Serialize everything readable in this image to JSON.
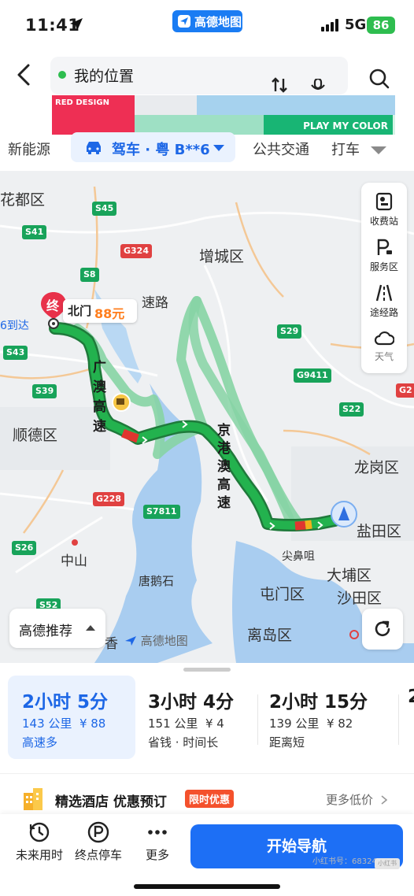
{
  "status_bar": {
    "time": "11:41",
    "network": "5G",
    "battery": "86",
    "app_badge": "高德地图"
  },
  "header": {
    "origin_text": "我的位置",
    "ad_banner": {
      "left_text": "RED DESIGN",
      "right_text": "PLAY MY COLOR"
    }
  },
  "mode_tabs": {
    "items": [
      "新能源",
      "驾车 · 粤 B**6",
      "公共交通",
      "打车"
    ],
    "active_index": 1
  },
  "map": {
    "labels": [
      "花都区",
      "增城区",
      "顺德区",
      "龙岗区",
      "中山",
      "唐鹅石",
      "屯门区",
      "大埔区",
      "沙田区",
      "离岛区",
      "盐田区",
      "尖鼻咀",
      "6到达",
      "香"
    ],
    "road_tags": [
      "S45",
      "S41",
      "G324",
      "S8",
      "S29",
      "S43",
      "G9411",
      "S39",
      "S22",
      "G228",
      "S7811",
      "S26",
      "S52",
      "G2"
    ],
    "route_texts": [
      "广澳高速",
      "京港澳高速",
      "速路"
    ],
    "dest_marker": "终",
    "parking": {
      "name": "北门",
      "icon_letter": "P",
      "price": "88元"
    },
    "tools": [
      "收费站",
      "服务区",
      "途经路",
      "天气"
    ],
    "recommend_button": "高德推荐",
    "watermark": "高德地图"
  },
  "routes": [
    {
      "duration": "2小时 5分",
      "distance": "143 公里",
      "toll": "¥ 88",
      "tag": "高速多",
      "selected": true
    },
    {
      "duration": "3小时 4分",
      "distance": "151 公里",
      "toll": "¥ 4",
      "tag": "省钱 · 时间长",
      "selected": false
    },
    {
      "duration": "2小时 15分",
      "distance": "139 公里",
      "toll": "¥ 82",
      "tag": "距离短",
      "selected": false
    },
    {
      "duration": "2",
      "distance": "",
      "toll": "",
      "tag": "",
      "selected": false
    }
  ],
  "hotel_promo": {
    "title": "精选酒店 优惠预订",
    "badge": "限时优惠",
    "more": "更多低价"
  },
  "bottom_bar": {
    "future_time": "未来用时",
    "dest_parking": "终点停车",
    "more": "更多",
    "start_nav": "开始导航",
    "watermark": "小红书号：683240911",
    "xhs_logo": "小红书"
  },
  "colors": {
    "brand_blue": "#1d6ff5",
    "route_green": "#23b24e",
    "alt_route_green": "#86d4a4",
    "congestion_red": "#e0352f",
    "parking_orange": "#ff7e1d"
  }
}
